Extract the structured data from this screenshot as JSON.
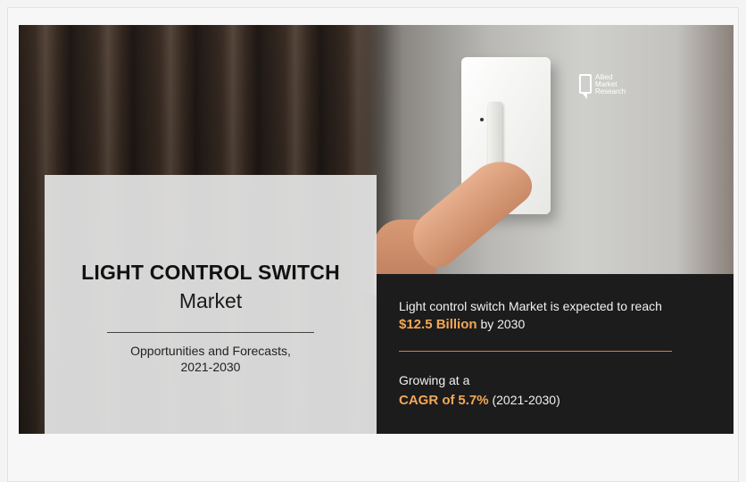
{
  "logo": {
    "line1": "Allied",
    "line2": "Market",
    "line3": "Research"
  },
  "title": {
    "main": "LIGHT CONTROL SWITCH",
    "sub": "Market",
    "forecast_line1": "Opportunities and Forecasts,",
    "forecast_line2": "2021-2030"
  },
  "stats": {
    "value_prefix": "Light control switch Market is expected to reach",
    "value": "$12.5 Billion",
    "value_suffix": "by 2030",
    "growth_prefix": "Growing at a",
    "cagr_label": "CAGR of",
    "cagr_value": "5.7%",
    "cagr_period": "(2021-2030)"
  },
  "colors": {
    "accent": "#f3a857",
    "panel_dark": "#1c1c1c",
    "panel_light": "#e2e2e2"
  }
}
